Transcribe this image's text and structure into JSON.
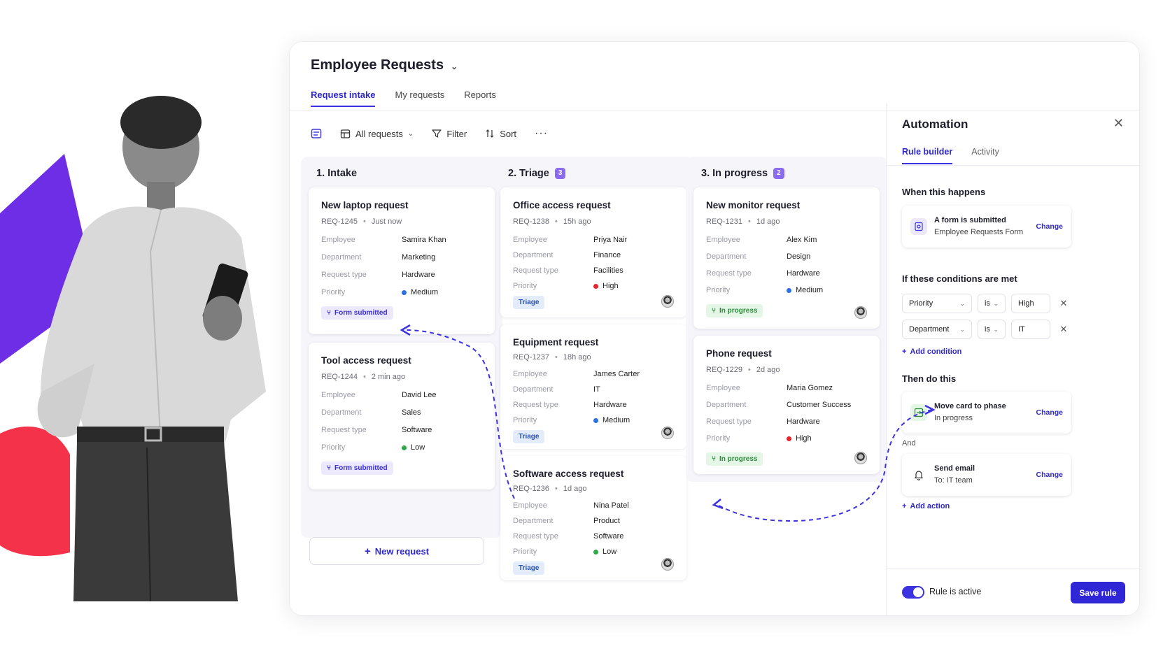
{
  "app": {
    "title": "Employee Requests",
    "tabs": [
      "Request intake",
      "My requests",
      "Reports"
    ],
    "active_tab": "Request intake"
  },
  "toolbar": {
    "view_label": "All requests",
    "filter_label": "Filter",
    "sort_label": "Sort"
  },
  "columns": [
    {
      "title": "1. Intake",
      "count": null,
      "cards": [
        {
          "title": "New laptop request",
          "id": "REQ-1245",
          "time": "Just now",
          "labels": [
            "Employee",
            "Department",
            "Request type",
            "Priority"
          ],
          "employee": "Samira Khan",
          "department": "Marketing",
          "request_type": "Hardware",
          "priority": "Medium",
          "status": "Form submitted"
        },
        {
          "title": "Tool access request",
          "id": "REQ-1244",
          "time": "2 min ago",
          "labels": [
            "Employee",
            "Department",
            "Request type",
            "Priority"
          ],
          "employee": "David Lee",
          "department": "Sales",
          "request_type": "Software",
          "priority": "Low",
          "status": "Form submitted"
        }
      ]
    },
    {
      "title": "2. Triage",
      "count": "3",
      "cards": [
        {
          "title": "Office access request",
          "id": "REQ-1238",
          "time": "15h ago",
          "labels": [
            "Employee",
            "Department",
            "Request type",
            "Priority"
          ],
          "employee": "Priya Nair",
          "department": "Finance",
          "request_type": "Facilities",
          "priority": "High",
          "status": "Triage"
        },
        {
          "title": "Equipment request",
          "id": "REQ-1237",
          "time": "18h ago",
          "labels": [
            "Employee",
            "Department",
            "Request type",
            "Priority"
          ],
          "employee": "James Carter",
          "department": "IT",
          "request_type": "Hardware",
          "priority": "Medium",
          "status": "Triage"
        },
        {
          "title": "Software access request",
          "id": "REQ-1236",
          "time": "1d ago",
          "labels": [
            "Employee",
            "Department",
            "Request type",
            "Priority"
          ],
          "employee": "Nina Patel",
          "department": "Product",
          "request_type": "Software",
          "priority": "Low",
          "status": "Triage"
        }
      ]
    },
    {
      "title": "3. In progress",
      "count": "2",
      "cards": [
        {
          "title": "New monitor request",
          "id": "REQ-1231",
          "time": "1d ago",
          "labels": [
            "Employee",
            "Department",
            "Request type",
            "Priority"
          ],
          "employee": "Alex Kim",
          "department": "Design",
          "request_type": "Hardware",
          "priority": "Medium",
          "status": "In progress"
        },
        {
          "title": "Phone request",
          "id": "REQ-1229",
          "time": "2d ago",
          "labels": [
            "Employee",
            "Department",
            "Request type",
            "Priority"
          ],
          "employee": "Maria Gomez",
          "department": "Customer Success",
          "request_type": "Hardware",
          "priority": "High",
          "status": "In progress"
        }
      ]
    }
  ],
  "new_request_label": "New request",
  "priority_colors": {
    "High": "#e5252b",
    "Medium": "#2d6fe0",
    "Low": "#2fa84a"
  },
  "automation": {
    "title": "Automation",
    "tabs": [
      "Rule builder",
      "Activity"
    ],
    "trigger_heading": "When this happens",
    "trigger": {
      "title": "A form is submitted",
      "subtitle": "Employee Requests Form",
      "change": "Change"
    },
    "conditions_heading": "If these conditions are met",
    "conditions": [
      {
        "field": "Priority",
        "op": "is",
        "value": "High"
      },
      {
        "field": "Department",
        "op": "is",
        "value": "IT"
      }
    ],
    "add_condition": "Add condition",
    "actions_heading": "Then do this",
    "action1": {
      "title": "Move card to phase",
      "subtitle": "In progress",
      "change": "Change"
    },
    "and_label": "And",
    "action2": {
      "title": "Send email",
      "subtitle": "To: IT team",
      "change": "Change"
    },
    "add_action": "Add action",
    "rule_active_label": "Rule is active",
    "save_label": "Save rule"
  },
  "colors": {
    "accent": "#3b33e0",
    "brand_purple": "#6d2ee6",
    "brand_red": "#f4324a"
  }
}
